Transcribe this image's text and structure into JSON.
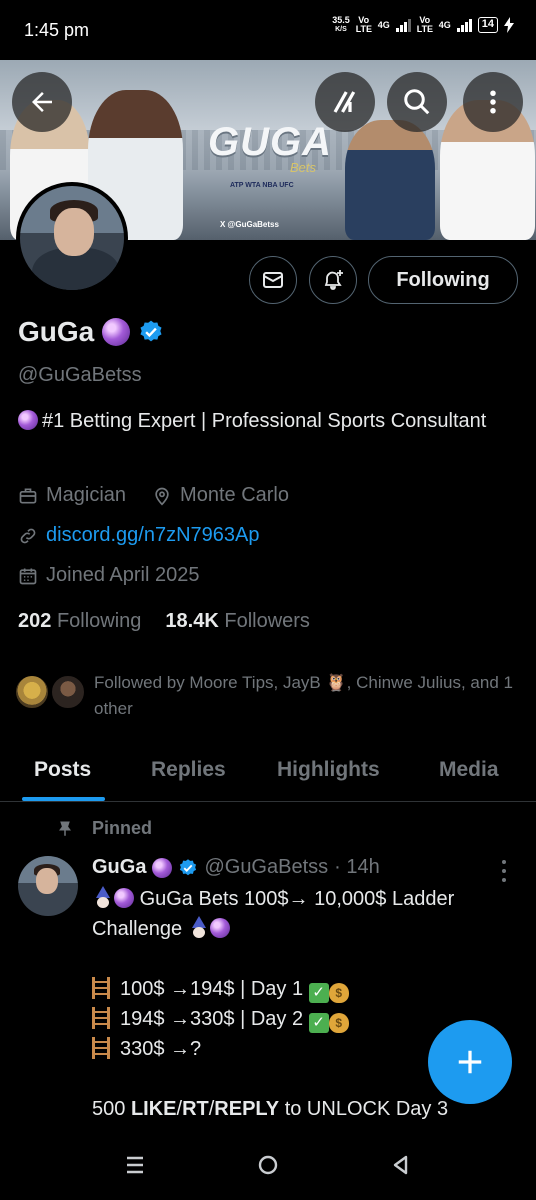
{
  "status_bar": {
    "time": "1:45 pm",
    "net_speed": "35.5",
    "net_speed_unit": "K/S",
    "sim1_label": "Vo LTE",
    "sim1_gen": "4G",
    "sim2_label": "Vo LTE",
    "sim2_gen": "4G",
    "battery": "14"
  },
  "banner": {
    "logo_text": "GUGA",
    "logo_sub": "Bets",
    "leagues": "ATP WTA NBA UFC",
    "handle": "X @GuGaBetss"
  },
  "header": {
    "back_icon": "back-arrow-icon",
    "grok_icon": "grok-icon",
    "search_icon": "search-icon",
    "more_icon": "more-vertical-icon"
  },
  "actions": {
    "message_icon": "envelope-icon",
    "notify_icon": "bell-plus-icon",
    "follow_label": "Following"
  },
  "profile": {
    "name": "GuGa",
    "handle": "@GuGaBetss",
    "bio": "#1 Betting Expert | Professional Sports Consultant",
    "occupation": "Magician",
    "location": "Monte Carlo",
    "website": "discord.gg/n7zN7963Ap",
    "joined": "Joined April 2025",
    "following_count": "202",
    "following_label": "Following",
    "followers_count": "18.4K",
    "followers_label": "Followers",
    "followed_by": "Followed by Moore Tips, JayB 🦉, Chinwe Julius, and 1 other"
  },
  "tabs": [
    {
      "label": "Posts"
    },
    {
      "label": "Replies"
    },
    {
      "label": "Highlights"
    },
    {
      "label": "Media"
    }
  ],
  "post": {
    "pinned_label": "Pinned",
    "author": "GuGa",
    "handle": "@GuGaBetss",
    "time": "· 14h",
    "line1": "GuGa Bets 100$→ 10,000$ Ladder Challenge",
    "row1": "100$ →194$ | Day 1",
    "row2": "194$ →330$ | Day 2",
    "row3": "330$ →?",
    "cta_pre": "500 ",
    "cta_like": "LIKE",
    "cta_sep1": "/",
    "cta_rt": "RT",
    "cta_sep2": "/",
    "cta_reply": "REPLY",
    "cta_post": " to UNLOCK Day 3"
  },
  "colors": {
    "accent": "#1d9bf0",
    "background": "#000000",
    "muted": "#71767b",
    "text": "#e7e9ea"
  }
}
